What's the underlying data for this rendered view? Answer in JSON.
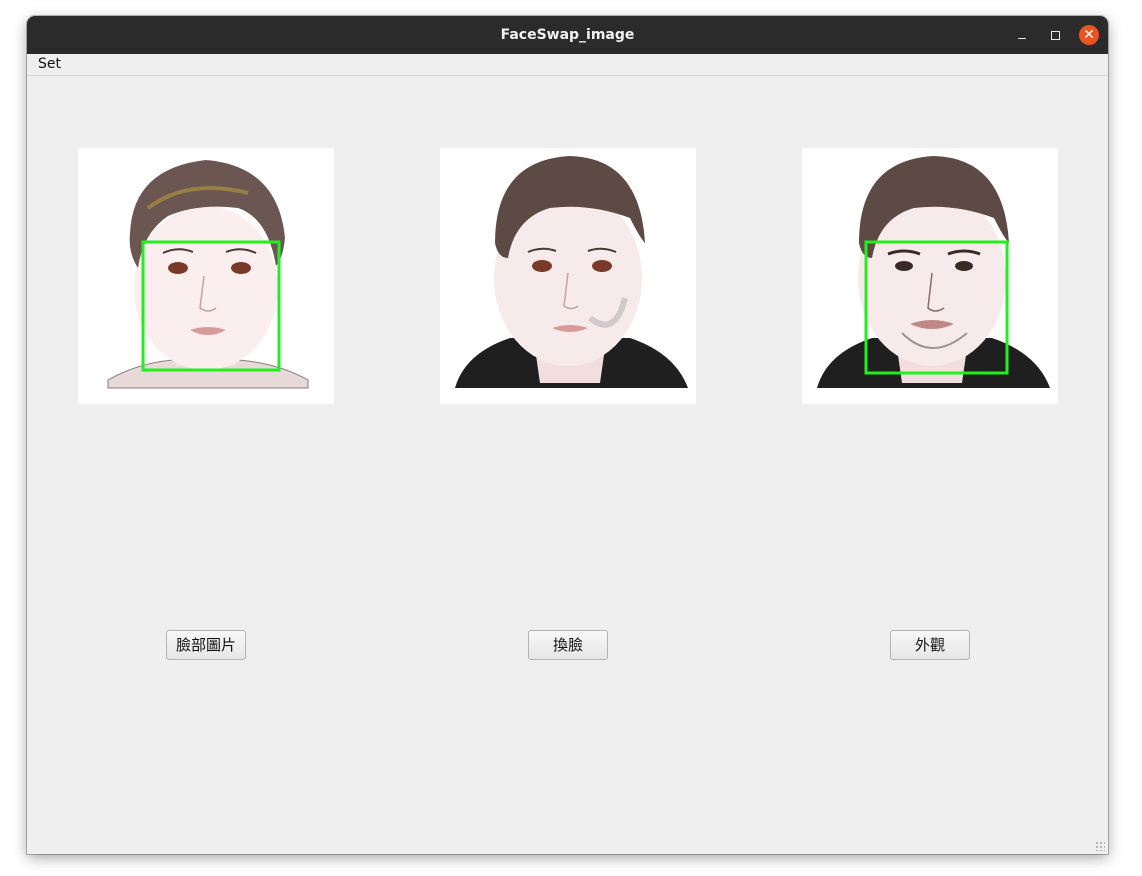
{
  "window": {
    "title": "FaceSwap_image",
    "close_glyph": "✕"
  },
  "menu": {
    "items": [
      "Set"
    ]
  },
  "panels": [
    {
      "name": "face-image",
      "has_detection_box": true
    },
    {
      "name": "swapped-face-image",
      "has_detection_box": false
    },
    {
      "name": "appearance-image",
      "has_detection_box": true
    }
  ],
  "buttons": {
    "face_image_label": "臉部圖片",
    "swap_face_label": "換臉",
    "appearance_label": "外觀"
  },
  "colors": {
    "titlebar": "#2b2b2b",
    "close_button": "#e95420",
    "window_bg": "#efefef",
    "detection_box": "#22ee22"
  },
  "icons": {
    "minimize": "minimize-icon",
    "maximize": "maximize-icon",
    "close": "close-icon"
  }
}
